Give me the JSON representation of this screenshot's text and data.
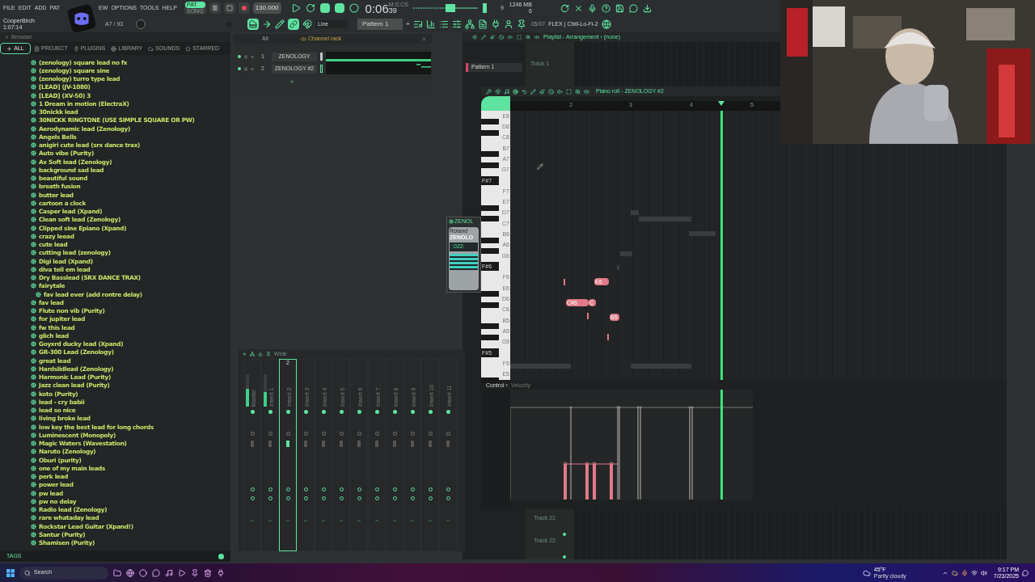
{
  "menu": [
    "FILE",
    "EDIT",
    "ADD",
    "PAT",
    "EW",
    "OPTIONS",
    "TOOLS",
    "HELP"
  ],
  "song": {
    "title": "CooperBirch",
    "length": "1:07:14",
    "hint": "A7 / 93"
  },
  "transport": {
    "modes": [
      {
        "label": "PAT",
        "selected": true
      },
      {
        "label": "SONG",
        "selected": false
      }
    ],
    "recording": false,
    "tempo": "130.000",
    "time": "0:06",
    "time_cs": "39",
    "time_unit": "M:S:CS",
    "cpu": "9",
    "memory": "1246 MB",
    "polyphony": "6"
  },
  "toolbar": {
    "snap": "Line",
    "pattern": "Pattern 1",
    "add": "+",
    "preset_index": "05/07",
    "preset": "FLEX | Chill-Lo-Fi-2"
  },
  "browser": {
    "title": "Browser",
    "tabs": [
      {
        "label": "ALL",
        "selected": true
      },
      {
        "label": "PROJECT",
        "selected": false
      },
      {
        "label": "PLUGINS",
        "selected": false
      },
      {
        "label": "LIBRARY",
        "selected": false
      },
      {
        "label": "SOUNDS",
        "selected": false
      },
      {
        "label": "STARRED",
        "selected": false
      }
    ],
    "items": [
      {
        "label": "(zenology) square lead no fx"
      },
      {
        "label": "(zenology) square sine"
      },
      {
        "label": "(zenology) turro type lead"
      },
      {
        "label": "[LEAD] (JV-1080)"
      },
      {
        "label": "[LEAD] (XV-50) 3"
      },
      {
        "label": "1 Dream in motion (ElectraX)"
      },
      {
        "label": "30nickk lead"
      },
      {
        "label": "30NICKK RINGTONE (USE SIMPLE SQUARE OR PW)"
      },
      {
        "label": "Aerodynamic lead (Zenology)"
      },
      {
        "label": "Angels Bells"
      },
      {
        "label": "anigiri cute lead (srx dance trax)"
      },
      {
        "label": "Auto vibe (Purity)"
      },
      {
        "label": "Ax Soft lead (Zenology)"
      },
      {
        "label": "background sad lead"
      },
      {
        "label": "beautiful sound"
      },
      {
        "label": "breath fusion"
      },
      {
        "label": "butter lead"
      },
      {
        "label": "cartoon a clock"
      },
      {
        "label": "Casper lead (Xpand)"
      },
      {
        "label": "Clean soft lead (Zenology)"
      },
      {
        "label": "Clipped sine Epiano (Xpand)"
      },
      {
        "label": "crazy leead"
      },
      {
        "label": "cute lead"
      },
      {
        "label": "cutting lead (zenology)"
      },
      {
        "label": "Digi lead (Xpand)"
      },
      {
        "label": "diva tell em lead"
      },
      {
        "label": "Dry Basslead (SRX DANCE TRAX)"
      },
      {
        "label": "fairytale",
        "children": [
          {
            "label": "fav lead ever (add rontre delay)"
          }
        ]
      },
      {
        "label": "fav lead"
      },
      {
        "label": "Flute non vib (Purity)"
      },
      {
        "label": "for jupiter lead"
      },
      {
        "label": "fw this lead"
      },
      {
        "label": "glich lead"
      },
      {
        "label": "Goyxrd ducky lead (Xpand)"
      },
      {
        "label": "GR-300 Lead (Zenology)"
      },
      {
        "label": "great lead"
      },
      {
        "label": "Hardslidlead (Zenology)"
      },
      {
        "label": "Harmonic Lead (Purity)"
      },
      {
        "label": "Jazz clean lead (Purity)"
      },
      {
        "label": "koto (Purity)"
      },
      {
        "label": "lead - cry babii"
      },
      {
        "label": "lead so nice"
      },
      {
        "label": "living broke lead"
      },
      {
        "label": "low key the best lead for long chords"
      },
      {
        "label": "Luminescent (Monopoly)"
      },
      {
        "label": "Magic Waters (Wavestation)"
      },
      {
        "label": "Naruto (Zenology)"
      },
      {
        "label": "Oburi (purity)"
      },
      {
        "label": "one of my main leads"
      },
      {
        "label": "perk lead"
      },
      {
        "label": "power lead"
      },
      {
        "label": "pw lead"
      },
      {
        "label": "pw no delay"
      },
      {
        "label": "Radio lead (Zenology)"
      },
      {
        "label": "rare whataday lead"
      },
      {
        "label": "Rockstar Lead Guitar (Xpand!)"
      },
      {
        "label": "Santur (Purity)"
      },
      {
        "label": "Shamisen (Purity)"
      }
    ],
    "footer": "TAGS"
  },
  "channel_rack": {
    "title": "Channel rack",
    "filter": "All",
    "channels": [
      {
        "number": "1",
        "name": "ZENOLOGY",
        "selected": false
      },
      {
        "number": "2",
        "name": "ZENOLOGY #2",
        "selected": true
      }
    ]
  },
  "playlist": {
    "title": "Playlist - Arrangement",
    "separator": "›",
    "crumb": "(none)",
    "patterns": [
      "Pattern 1"
    ],
    "tracks_top": [
      "Track 1"
    ],
    "tracks_bottom": [
      "Track 21",
      "Track 22"
    ]
  },
  "plugin": {
    "title": "ZENOL",
    "brand": "Roland",
    "logo": "ZENOLO",
    "preset": "022:"
  },
  "piano_roll": {
    "title": "Piano roll - ZENOLOGY #2",
    "bars": [
      "2",
      "3",
      "4",
      "5"
    ],
    "keys": [
      "E8",
      "D8",
      "C8",
      "B7",
      "A7",
      "G7",
      "F#7",
      "F7",
      "E7",
      "D7",
      "C7",
      "B6",
      "A6",
      "G6",
      "F#6",
      "F6",
      "E6",
      "D6",
      "C6",
      "B5",
      "A5",
      "G5",
      "F#5",
      "F5",
      "E5"
    ],
    "notes": [
      {
        "label": "E6"
      },
      {
        "label": "C#6"
      },
      {
        "label": "C"
      },
      {
        "label": "B5"
      }
    ],
    "control": "Control",
    "control_separator": "›",
    "control_param": "Velocity"
  },
  "mixer": {
    "preset": "Wide",
    "header": "2",
    "tracks": [
      {
        "label": "Master",
        "level": 0.55,
        "selected": false
      },
      {
        "label": "Insert 1",
        "level": 0.45,
        "selected": false
      },
      {
        "label": "Insert 2",
        "selected": true
      },
      {
        "label": "Insert 3",
        "selected": false
      },
      {
        "label": "Insert 4",
        "selected": false
      },
      {
        "label": "Insert 5",
        "selected": false
      },
      {
        "label": "Insert 6",
        "selected": false
      },
      {
        "label": "Insert 7",
        "selected": false
      },
      {
        "label": "Insert 8",
        "selected": false
      },
      {
        "label": "Insert 9",
        "selected": false
      },
      {
        "label": "Insert 10",
        "selected": false
      },
      {
        "label": "Insert 11",
        "selected": false
      }
    ]
  },
  "taskbar": {
    "search": "Search",
    "temperature": "45°F",
    "weather": "Partly cloudy",
    "time": "9:17 PM",
    "date": "7/23/2025"
  }
}
